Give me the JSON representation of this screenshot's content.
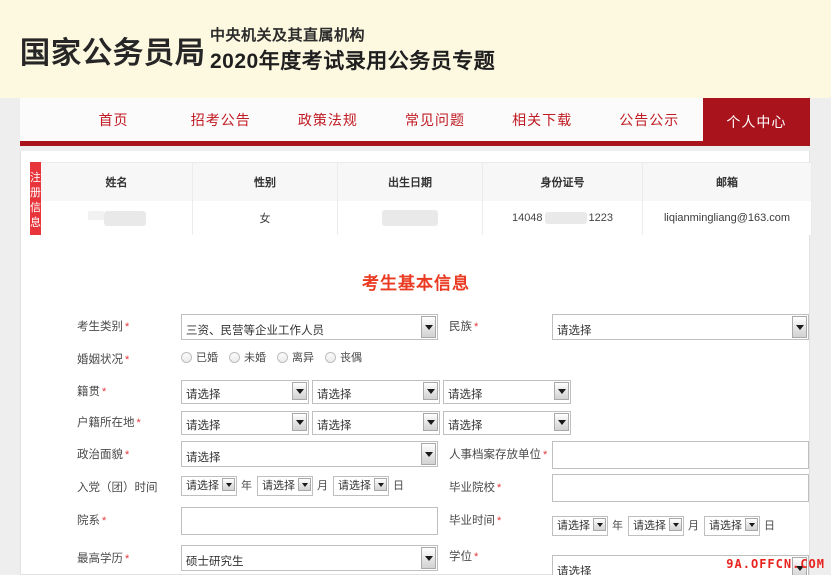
{
  "header": {
    "logo": "国家公务员局",
    "sub_line1": "中央机关及其直属机构",
    "sub_line2": "2020年度考试录用公务员专题",
    "bg_color": "#fdf8e0"
  },
  "nav": {
    "accent_color": "#a8131c",
    "items": [
      {
        "label": "首页",
        "active": false
      },
      {
        "label": "招考公告",
        "active": false
      },
      {
        "label": "政策法规",
        "active": false
      },
      {
        "label": "常见问题",
        "active": false
      },
      {
        "label": "相关下载",
        "active": false
      },
      {
        "label": "公告公示",
        "active": false
      },
      {
        "label": "个人中心",
        "active": true
      }
    ]
  },
  "reg_info": {
    "tag": "注册信息",
    "tag_color": "#e8353c",
    "columns": [
      "姓名",
      "性别",
      "出生日期",
      "身份证号",
      "邮箱"
    ],
    "row": {
      "name": "",
      "name_masked": true,
      "gender": "女",
      "birthdate": "",
      "birthdate_masked": true,
      "id_prefix": "14048",
      "id_suffix": "1223",
      "id_masked": true,
      "email": "liqianmingliang@163.com"
    }
  },
  "form": {
    "title": "考生基本信息",
    "title_color": "#ea3b22",
    "placeholder": "请选择",
    "fields": {
      "candidate_type": {
        "label": "考生类别",
        "required": true,
        "value": "三资、民营等企业工作人员"
      },
      "ethnicity": {
        "label": "民族",
        "required": true,
        "value": "请选择"
      },
      "marital_status": {
        "label": "婚姻状况",
        "required": true,
        "options": [
          "已婚",
          "未婚",
          "离异",
          "丧偶"
        ],
        "selected": ""
      },
      "native_place": {
        "label": "籍贯",
        "required": true,
        "values": [
          "请选择",
          "请选择",
          "请选择"
        ]
      },
      "household_location": {
        "label": "户籍所在地",
        "required": true,
        "values": [
          "请选择",
          "请选择",
          "请选择"
        ]
      },
      "political_status": {
        "label": "政治面貌",
        "required": true,
        "value": "请选择"
      },
      "archive_unit": {
        "label": "人事档案存放单位",
        "required": true,
        "value": ""
      },
      "party_join_time": {
        "label": "入党（团）时间",
        "required": false,
        "values": [
          "请选择",
          "请选择",
          "请选择"
        ],
        "units": [
          "年",
          "月",
          "日"
        ]
      },
      "graduate_school": {
        "label": "毕业院校",
        "required": true,
        "value": ""
      },
      "department": {
        "label": "院系",
        "required": true,
        "value": ""
      },
      "graduate_time": {
        "label": "毕业时间",
        "required": true,
        "values": [
          "请选择",
          "请选择",
          "请选择"
        ],
        "units": [
          "年",
          "月",
          "日"
        ]
      },
      "highest_education": {
        "label": "最高学历",
        "required": true,
        "value": "硕士研究生"
      },
      "degree": {
        "label": "学位",
        "required": true,
        "value": "请选择"
      }
    }
  },
  "watermark": {
    "text": "9A.OFFCN.COM",
    "color": "#e8231e"
  }
}
